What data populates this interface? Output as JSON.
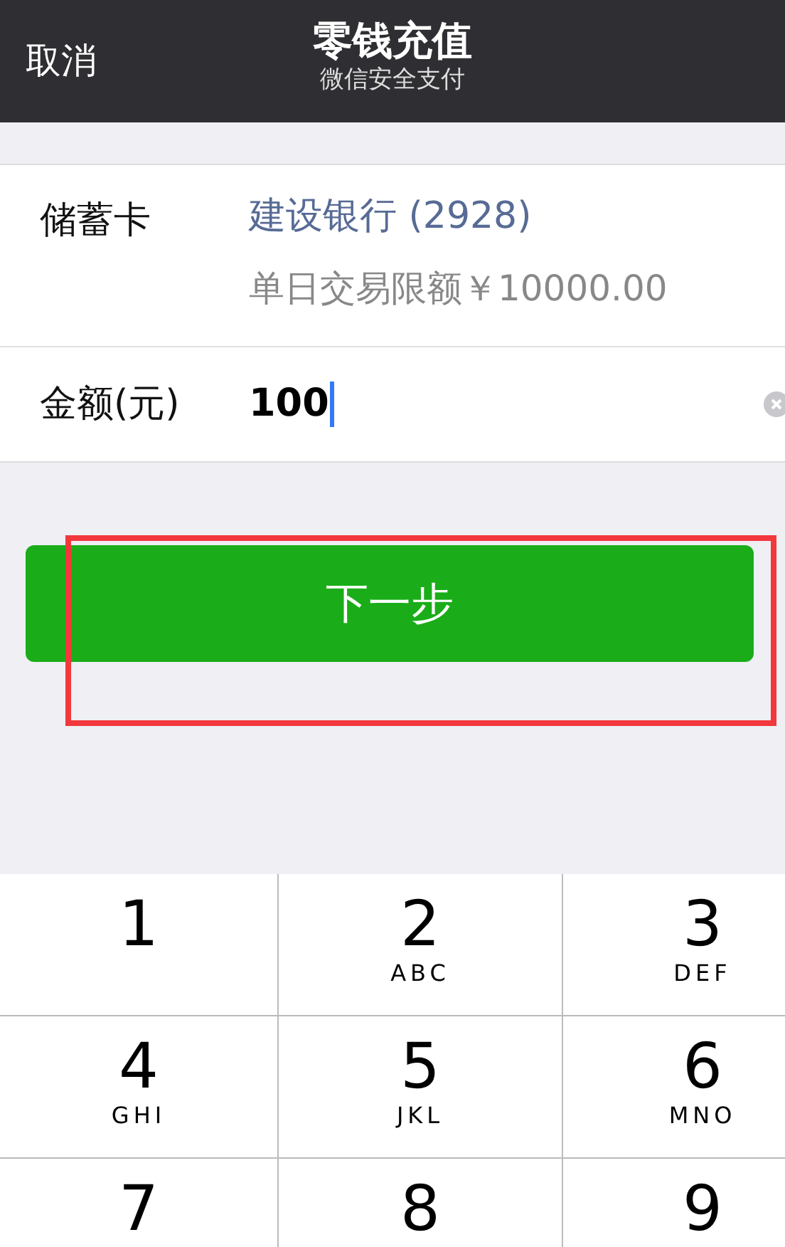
{
  "nav_bar": {
    "cancel": "取消",
    "title": "零钱充值",
    "subtitle": "微信安全支付"
  },
  "card": {
    "label": "储蓄卡",
    "bank": "建设银行 (2928)",
    "limit": "单日交易限额￥10000.00"
  },
  "amount": {
    "label": "金额(元)",
    "value": "100",
    "focused": true
  },
  "next_button": {
    "label": "下一步",
    "highlighted": true
  },
  "keypad": [
    {
      "digit": "1"
    },
    {
      "digit": "2",
      "letters": "ABC"
    },
    {
      "digit": "3",
      "letters": "DEF"
    },
    {
      "digit": "4",
      "letters": "GHI"
    },
    {
      "digit": "5",
      "letters": "JKL"
    },
    {
      "digit": "6",
      "letters": "MNO"
    },
    {
      "digit": "7"
    },
    {
      "digit": "8"
    },
    {
      "digit": "9"
    }
  ]
}
